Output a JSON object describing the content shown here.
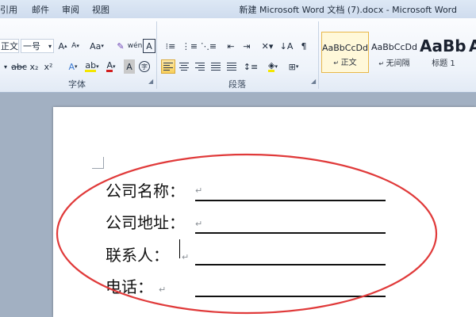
{
  "window": {
    "title": "新建 Microsoft Word 文档 (7).docx - Microsoft Word",
    "tabs": [
      "引用",
      "邮件",
      "审阅",
      "视图"
    ]
  },
  "ribbon": {
    "font_group": {
      "label": "字体",
      "font_name": "正文",
      "font_size": "一号",
      "grow_label": "A",
      "shrink_label": "A",
      "case_label": "Aa",
      "phonetic_label": "wén",
      "border_char_label": "A",
      "superscript": "x²",
      "text_effect_label": "A",
      "font_color_label": "A",
      "char_shade_label": "A",
      "enclose_label": "字"
    },
    "paragraph_group": {
      "label": "段落"
    },
    "styles": [
      {
        "sample": "AaBbCcDd",
        "name": "正文",
        "selected": true
      },
      {
        "sample": "AaBbCcDd",
        "name": "无间隔",
        "selected": false
      },
      {
        "sample": "AaBb",
        "name": "标题 1",
        "selected": false
      }
    ]
  },
  "document": {
    "lines": [
      {
        "label": "公司名称："
      },
      {
        "label": "公司地址："
      },
      {
        "label": "联系人："
      },
      {
        "label": "电话："
      }
    ],
    "paragraph_mark": "↵",
    "annotation_color": "#e03a3a"
  }
}
